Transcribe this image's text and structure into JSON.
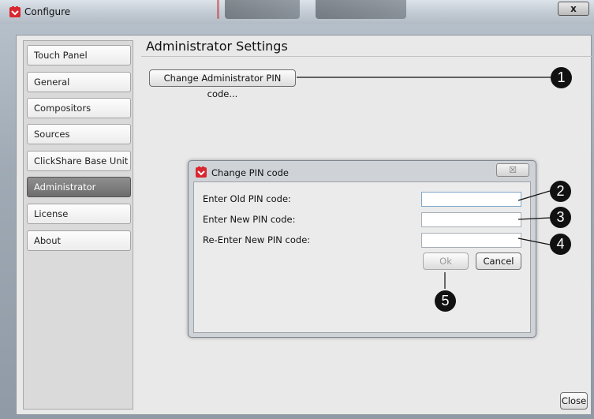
{
  "window": {
    "title": "Configure",
    "close_glyph": "x"
  },
  "sidebar": {
    "items": [
      {
        "label": "Touch Panel",
        "active": false
      },
      {
        "label": "General",
        "active": false
      },
      {
        "label": "Compositors",
        "active": false
      },
      {
        "label": "Sources",
        "active": false
      },
      {
        "label": "ClickShare Base Unit",
        "active": false
      },
      {
        "label": "Administrator",
        "active": true
      },
      {
        "label": "License",
        "active": false
      },
      {
        "label": "About",
        "active": false
      }
    ]
  },
  "main": {
    "title": "Administrator Settings",
    "change_pin_button": "Change Administrator PIN code...",
    "close_button": "Close"
  },
  "dialog": {
    "title": "Change PIN code",
    "close_glyph": "☒",
    "old_pin_label": "Enter Old PIN code:",
    "new_pin_label": "Enter New PIN code:",
    "reenter_pin_label": "Re-Enter New PIN code:",
    "old_pin_value": "",
    "new_pin_value": "",
    "reenter_pin_value": "",
    "ok_button": "Ok",
    "cancel_button": "Cancel"
  },
  "callouts": [
    "1",
    "2",
    "3",
    "4",
    "5"
  ],
  "icons": {
    "app": "clickshare-app-icon"
  },
  "colors": {
    "accent": "#d9262f",
    "active_nav": "#7a7a7a"
  }
}
